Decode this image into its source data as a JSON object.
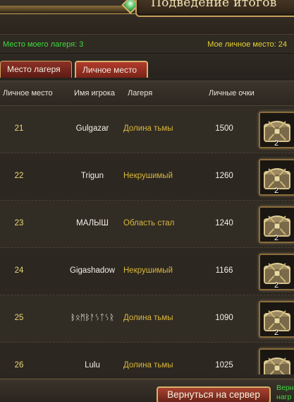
{
  "header": {
    "title": "Подведение итогов"
  },
  "info": {
    "my_camp_place": "Место моего лагеря: 3",
    "my_personal_place": "Мое личное место: 24"
  },
  "tabs": [
    {
      "label": "Место лагеря",
      "active": false
    },
    {
      "label": "Личное место",
      "active": true
    }
  ],
  "table": {
    "columns": [
      "Личное место",
      "Имя игрока",
      "Лагеря",
      "Личные очки"
    ],
    "rows": [
      {
        "rank": "21",
        "name": "Gulgazar",
        "camp": "Долина тьмы",
        "points": "1500",
        "reward": {
          "icon": "treasure-chest-icon",
          "count": "2"
        }
      },
      {
        "rank": "22",
        "name": "Trigun",
        "camp": "Некрушимый",
        "points": "1260",
        "reward": {
          "icon": "treasure-chest-icon",
          "count": "2"
        }
      },
      {
        "rank": "23",
        "name": "МАЛЫШ",
        "camp": "Область стал",
        "points": "1240",
        "reward": {
          "icon": "treasure-chest-icon",
          "count": "2"
        }
      },
      {
        "rank": "24",
        "name": "Gigashadow",
        "camp": "Некрушимый",
        "points": "1166",
        "reward": {
          "icon": "treasure-chest-icon",
          "count": "2"
        }
      },
      {
        "rank": "25",
        "name": "ᛒᛟᛗᛒᚨᛊᛏᛊᚱ",
        "camp": "Долина тьмы",
        "points": "1090",
        "reward": {
          "icon": "treasure-chest-icon",
          "count": "2"
        }
      },
      {
        "rank": "26",
        "name": "Lulu",
        "camp": "Долина тьмы",
        "points": "1025",
        "reward": {
          "icon": "treasure-chest-icon",
          "count": "2"
        }
      }
    ]
  },
  "footer": {
    "return_button": "Вернуться на сервер",
    "side_note": "Верн нагр"
  },
  "colors": {
    "accent_gold": "#d8b46a",
    "tab_red": "#8d3126",
    "green_text": "#3fdb3f",
    "yellow_text": "#e6d234",
    "camp_text": "#d9b73c"
  }
}
